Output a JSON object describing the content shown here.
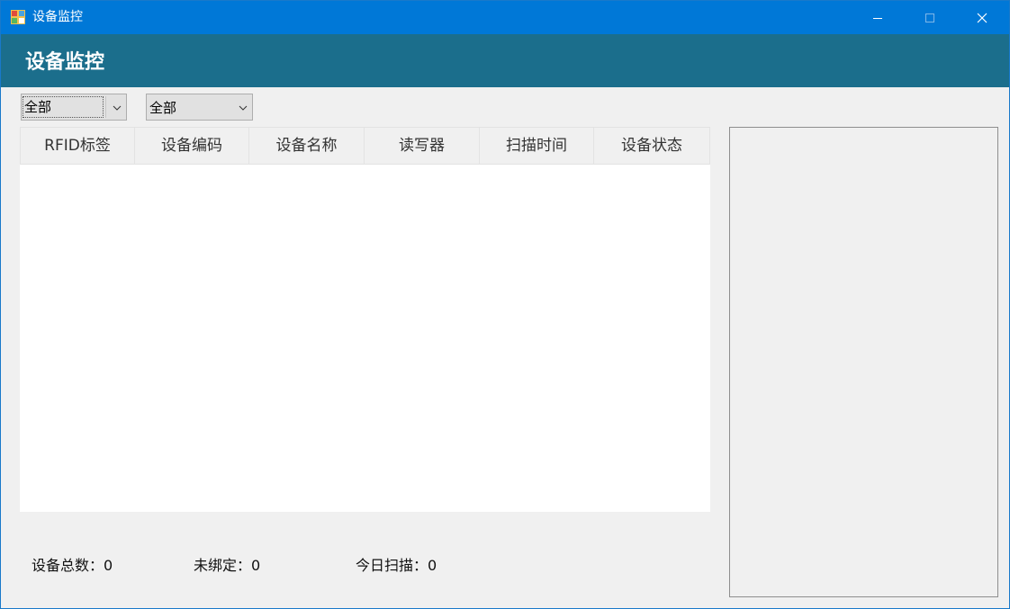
{
  "window": {
    "title": "设备监控",
    "icon": "app-grid-icon",
    "controls": [
      "minimize-icon",
      "maximize-icon",
      "close-icon"
    ]
  },
  "header": {
    "title": "设备监控"
  },
  "filters": {
    "filter1": {
      "value": "全部"
    },
    "filter2": {
      "value": "全部"
    }
  },
  "table": {
    "columns": [
      "RFID标签",
      "设备编码",
      "设备名称",
      "读写器",
      "扫描时间",
      "设备状态"
    ],
    "rows": []
  },
  "stats": {
    "total": "设备总数：0",
    "unbound": "未绑定：0",
    "today": "今日扫描：0"
  },
  "colors": {
    "titlebar": "#0078d7",
    "header_band": "#1b6e8c",
    "background": "#f0f0f0"
  }
}
